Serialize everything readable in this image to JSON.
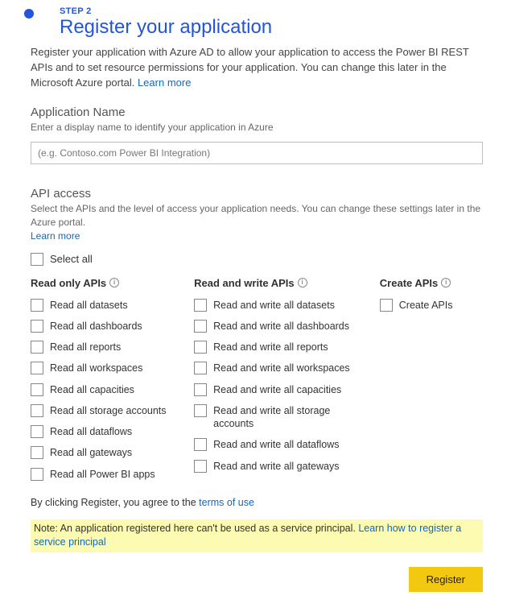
{
  "step": {
    "label": "STEP 2"
  },
  "title": "Register your application",
  "intro": {
    "text": "Register your application with Azure AD to allow your application to access the Power BI REST APIs and to set resource permissions for your application. You can change this later in the Microsoft Azure portal. ",
    "learn_more": "Learn more"
  },
  "app_name": {
    "title": "Application Name",
    "sub": "Enter a display name to identify your application in Azure",
    "placeholder": "(e.g. Contoso.com Power BI Integration)"
  },
  "api": {
    "title": "API access",
    "sub": "Select the APIs and the level of access your application needs. You can change these settings later in the Azure portal.",
    "learn_more": "Learn more",
    "select_all": "Select all",
    "cols": {
      "read": {
        "head": "Read only APIs",
        "items": [
          "Read all datasets",
          "Read all dashboards",
          "Read all reports",
          "Read all workspaces",
          "Read all capacities",
          "Read all storage accounts",
          "Read all dataflows",
          "Read all gateways",
          "Read all Power BI apps"
        ]
      },
      "rw": {
        "head": "Read and write APIs",
        "items": [
          "Read and write all datasets",
          "Read and write all dashboards",
          "Read and write all reports",
          "Read and write all workspaces",
          "Read and write all capacities",
          "Read and write all storage accounts",
          "Read and write all dataflows",
          "Read and write all gateways"
        ]
      },
      "create": {
        "head": "Create APIs",
        "items": [
          "Create APIs"
        ]
      }
    }
  },
  "agree": {
    "text": "By clicking Register, you agree to the ",
    "link": "terms of use"
  },
  "note": {
    "text": "Note: An application registered here can't be used as a service principal. ",
    "link": "Learn how to register a service principal"
  },
  "register": "Register"
}
